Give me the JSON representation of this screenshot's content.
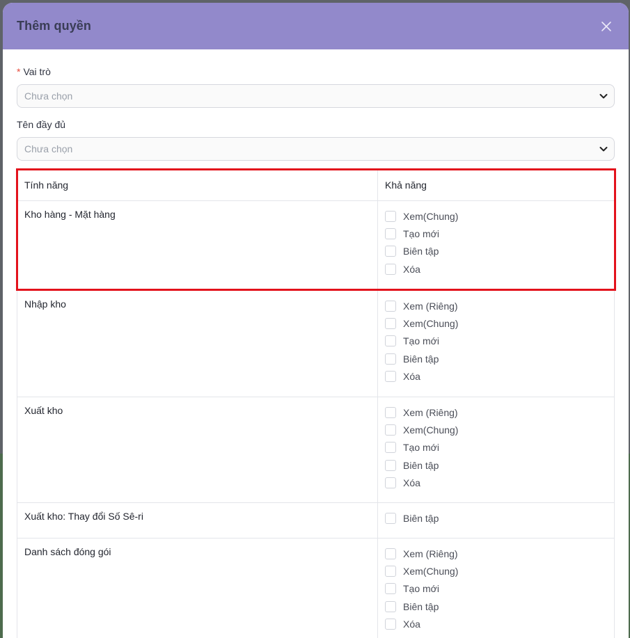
{
  "dialog": {
    "title": "Thêm quyền",
    "close_icon": "close-icon"
  },
  "form": {
    "role": {
      "label": "Vai trò",
      "required": true,
      "placeholder": "Chưa chọn"
    },
    "full_name": {
      "label": "Tên đầy đủ",
      "placeholder": "Chưa chọn"
    }
  },
  "permissions_table": {
    "headers": {
      "feature": "Tính năng",
      "capability": "Khả năng"
    },
    "rows": [
      {
        "feature": "Kho hàng - Mặt hàng",
        "capabilities": [
          "Xem(Chung)",
          "Tạo mới",
          "Biên tập",
          "Xóa"
        ]
      },
      {
        "feature": "Nhập kho",
        "capabilities": [
          "Xem (Riêng)",
          "Xem(Chung)",
          "Tạo mới",
          "Biên tập",
          "Xóa"
        ]
      },
      {
        "feature": "Xuất kho",
        "capabilities": [
          "Xem (Riêng)",
          "Xem(Chung)",
          "Tạo mới",
          "Biên tập",
          "Xóa"
        ]
      },
      {
        "feature": "Xuất kho: Thay đổi Số Sê-ri",
        "capabilities": [
          "Biên tập"
        ]
      },
      {
        "feature": "Danh sách đóng gói",
        "capabilities": [
          "Xem (Riêng)",
          "Xem(Chung)",
          "Tạo mới",
          "Biên tập",
          "Xóa"
        ]
      }
    ]
  },
  "colors": {
    "header_bg": "#9289cb",
    "highlight_border": "#e3121c",
    "required_star": "#e74c3c"
  }
}
